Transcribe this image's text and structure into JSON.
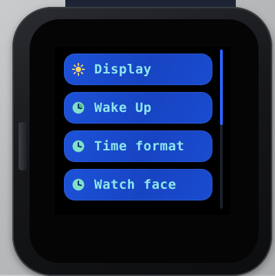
{
  "menu": {
    "items": [
      {
        "label": "Display",
        "icon": "sun-icon"
      },
      {
        "label": "Wake Up",
        "icon": "clock-icon"
      },
      {
        "label": "Time format",
        "icon": "clock-icon"
      },
      {
        "label": "Watch face",
        "icon": "clock-icon"
      }
    ]
  },
  "colors": {
    "item_background": "#1d52d9",
    "label_text": "#8fe7ee",
    "icon": "#7ee0c8",
    "scroll_thumb": "#2a66ff"
  },
  "scroll": {
    "position_fraction": 0
  }
}
